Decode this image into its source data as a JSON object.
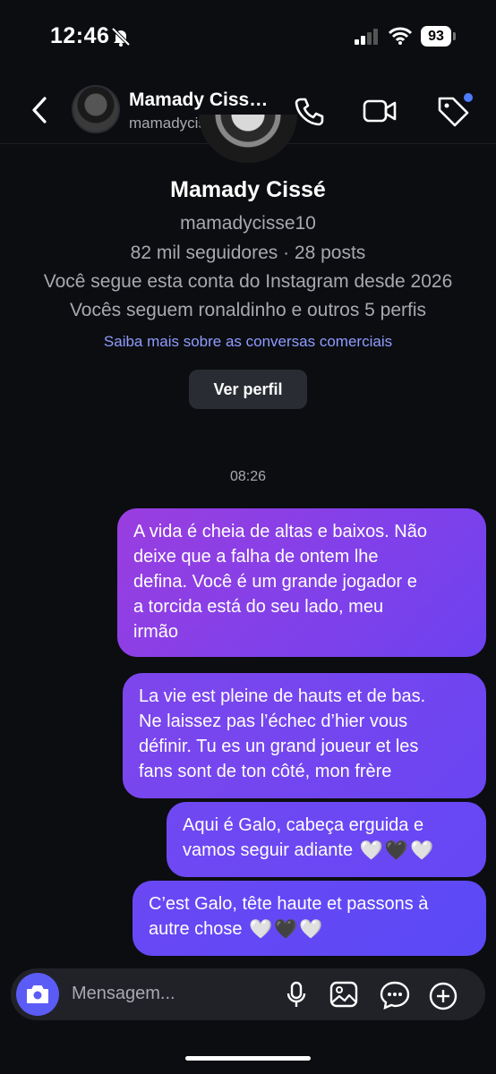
{
  "status_bar": {
    "time": "12:46",
    "battery": "93"
  },
  "header": {
    "name": "Mamady Ciss…",
    "username": "mamadycisse10"
  },
  "profile": {
    "name": "Mamady Cissé",
    "username": "mamadycisse10",
    "stats": "82 mil seguidores · 28 posts",
    "follow_since": "Você segue esta conta do Instagram desde 2026",
    "mutual": "Vocês seguem ronaldinho e outros 5 perfis",
    "link": "Saiba mais sobre as conversas comerciais",
    "view_profile_button": "Ver perfil"
  },
  "timestamp": "08:26",
  "messages": [
    {
      "lines": [
        "A vida é cheia de altas e baixos. Não",
        "deixe que a falha de ontem lhe",
        "defina. Você é um grande jogador e",
        "a torcida está do seu lado, meu",
        "irmão"
      ]
    },
    {
      "lines": [
        "La vie est pleine de hauts et de bas.",
        "Ne laissez pas l’échec d’hier vous",
        "définir. Tu es un grand joueur et les",
        "fans sont de ton côté, mon frère"
      ]
    },
    {
      "lines": [
        "Aqui é Galo, cabeça erguida e",
        "vamos seguir adiante"
      ]
    },
    {
      "lines": [
        "C’est Galo, tête haute et passons à",
        "autre chose"
      ]
    }
  ],
  "hearts": {
    "white": "🤍",
    "black": "🖤"
  },
  "composer": {
    "placeholder": "Mensagem..."
  },
  "colors": {
    "accent": "#5b5cf6",
    "background": "#0c0d11",
    "link": "#8f9cff"
  },
  "icons": [
    "back-icon",
    "phone-icon",
    "video-icon",
    "tag-icon",
    "camera-icon",
    "microphone-icon",
    "gallery-icon",
    "sticker-icon",
    "plus-icon"
  ]
}
